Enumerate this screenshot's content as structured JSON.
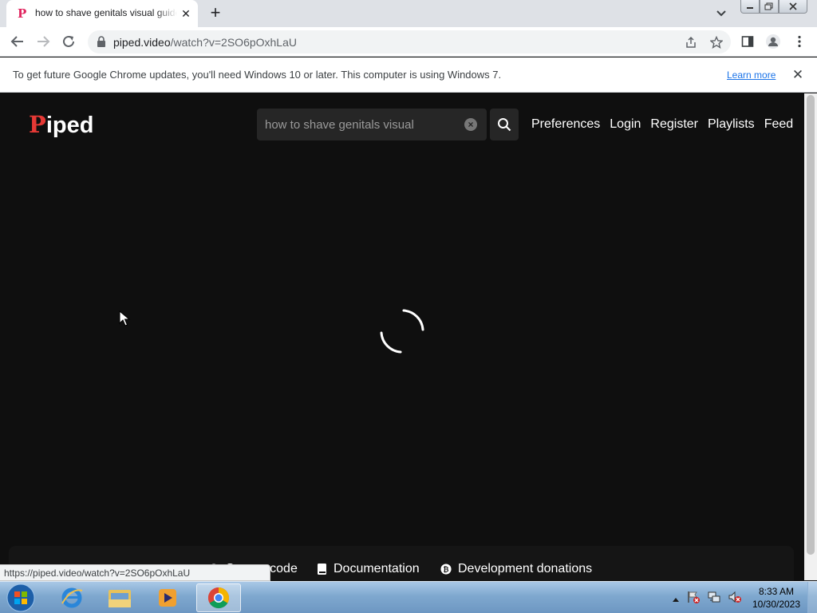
{
  "browser": {
    "tab": {
      "title": "how to shave genitals visual guide",
      "favicon": "piped-favicon"
    },
    "url": {
      "host": "piped.video",
      "path": "/watch?v=2SO6pOxhLaU"
    },
    "status_url": "https://piped.video/watch?v=2SO6pOxhLaU"
  },
  "infobar": {
    "message": "To get future Google Chrome updates, you'll need Windows 10 or later. This computer is using Windows 7.",
    "link": "Learn more"
  },
  "site": {
    "logo_first": "P",
    "logo_rest": "iped",
    "search_value": "how to shave genitals visual",
    "nav": [
      "Preferences",
      "Login",
      "Register",
      "Playlists",
      "Feed"
    ],
    "footer": {
      "source": "Source code",
      "docs": "Documentation",
      "donations": "Development donations"
    }
  },
  "taskbar": {
    "time": "8:33 AM",
    "date": "10/30/2023"
  },
  "colors": {
    "accent": "#e53935",
    "page_bg": "#0f0f0f"
  }
}
